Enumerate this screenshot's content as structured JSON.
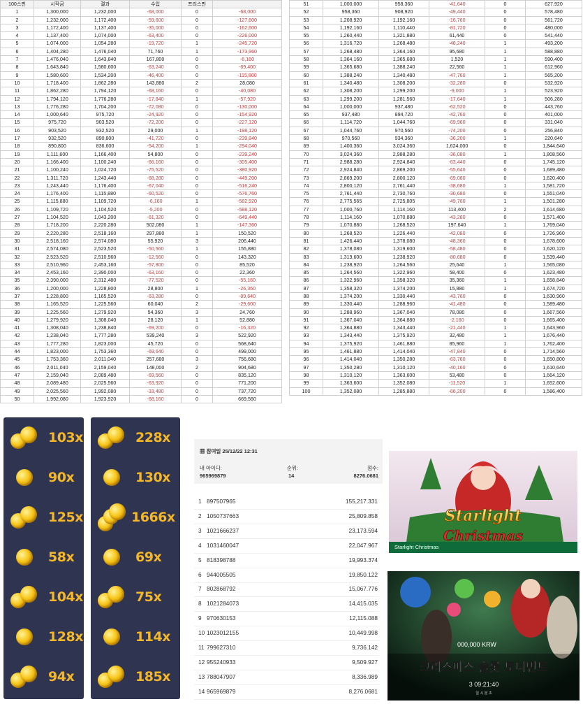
{
  "spin_table": {
    "headers": [
      "100스핀",
      "시작금",
      "결과",
      "수입",
      "프리스핀",
      ""
    ],
    "rows_left": [
      [
        "1",
        "1,300,000",
        "1,232,000",
        "-68,000",
        "0",
        "-68,000"
      ],
      [
        "2",
        "1,232,000",
        "1,172,400",
        "-59,600",
        "0",
        "-127,600"
      ],
      [
        "3",
        "1,172,400",
        "1,137,400",
        "-35,000",
        "0",
        "-162,600"
      ],
      [
        "4",
        "1,137,400",
        "1,074,000",
        "-63,400",
        "0",
        "-226,000"
      ],
      [
        "5",
        "1,074,000",
        "1,054,280",
        "-19,720",
        "1",
        "-245,720"
      ],
      [
        "6",
        "1,404,280",
        "1,476,040",
        "71,760",
        "1",
        "-173,960"
      ],
      [
        "7",
        "1,476,040",
        "1,643,840",
        "167,800",
        "0",
        "-6,160"
      ],
      [
        "8",
        "1,643,840",
        "1,580,600",
        "-63,240",
        "0",
        "-69,400"
      ],
      [
        "9",
        "1,580,600",
        "1,534,200",
        "-46,400",
        "0",
        "-115,800"
      ],
      [
        "10",
        "1,718,400",
        "1,862,280",
        "143,880",
        "2",
        "28,080"
      ],
      [
        "11",
        "1,862,280",
        "1,794,120",
        "-68,160",
        "0",
        "-40,080"
      ],
      [
        "12",
        "1,794,120",
        "1,776,280",
        "-17,840",
        "1",
        "-57,920"
      ],
      [
        "13",
        "1,776,280",
        "1,704,200",
        "-72,080",
        "0",
        "-130,000"
      ],
      [
        "14",
        "1,000,640",
        "975,720",
        "-24,920",
        "0",
        "-154,920"
      ],
      [
        "15",
        "975,720",
        "903,520",
        "-72,200",
        "0",
        "-227,120"
      ],
      [
        "16",
        "903,520",
        "932,520",
        "29,000",
        "1",
        "-198,120"
      ],
      [
        "17",
        "932,520",
        "890,800",
        "-41,720",
        "0",
        "-239,840"
      ],
      [
        "18",
        "890,800",
        "836,600",
        "-54,200",
        "1",
        "-294,040"
      ],
      [
        "19",
        "1,111,600",
        "1,166,400",
        "54,800",
        "0",
        "-239,240"
      ],
      [
        "20",
        "1,166,400",
        "1,100,240",
        "-66,160",
        "0",
        "-305,400"
      ],
      [
        "21",
        "1,100,240",
        "1,024,720",
        "-75,520",
        "0",
        "-380,920"
      ],
      [
        "22",
        "1,311,720",
        "1,243,440",
        "-68,280",
        "0",
        "-449,200"
      ],
      [
        "23",
        "1,243,440",
        "1,176,400",
        "-67,040",
        "0",
        "-516,240"
      ],
      [
        "24",
        "1,176,400",
        "1,115,880",
        "-60,520",
        "0",
        "-576,760"
      ],
      [
        "25",
        "1,115,880",
        "1,109,720",
        "-6,160",
        "1",
        "-582,920"
      ],
      [
        "26",
        "1,109,720",
        "1,104,520",
        "-5,200",
        "0",
        "-588,120"
      ],
      [
        "27",
        "1,104,520",
        "1,043,200",
        "-61,320",
        "0",
        "-649,440"
      ],
      [
        "28",
        "1,718,200",
        "2,220,280",
        "502,080",
        "1",
        "-147,360"
      ],
      [
        "29",
        "2,220,280",
        "2,518,160",
        "297,880",
        "1",
        "150,520"
      ],
      [
        "30",
        "2,518,160",
        "2,574,080",
        "55,920",
        "3",
        "206,440"
      ],
      [
        "31",
        "2,574,080",
        "2,523,520",
        "-50,560",
        "1",
        "155,880"
      ],
      [
        "32",
        "2,523,520",
        "2,510,960",
        "-12,560",
        "0",
        "143,320"
      ],
      [
        "33",
        "2,510,960",
        "2,453,160",
        "-57,800",
        "0",
        "85,520"
      ],
      [
        "34",
        "2,453,160",
        "2,390,000",
        "-63,160",
        "0",
        "22,360"
      ],
      [
        "35",
        "2,390,000",
        "2,312,480",
        "-77,520",
        "0",
        "-55,160"
      ],
      [
        "36",
        "1,200,000",
        "1,228,800",
        "28,800",
        "1",
        "-26,360"
      ],
      [
        "37",
        "1,228,800",
        "1,165,520",
        "-63,280",
        "0",
        "-89,640"
      ],
      [
        "38",
        "1,165,520",
        "1,225,560",
        "60,040",
        "2",
        "-29,600"
      ],
      [
        "39",
        "1,225,560",
        "1,279,920",
        "54,360",
        "3",
        "24,760"
      ],
      [
        "40",
        "1,279,920",
        "1,308,040",
        "28,120",
        "1",
        "52,880"
      ],
      [
        "41",
        "1,308,040",
        "1,238,840",
        "-69,200",
        "0",
        "-16,320"
      ],
      [
        "42",
        "1,238,040",
        "1,777,280",
        "539,240",
        "3",
        "522,920"
      ],
      [
        "43",
        "1,777,280",
        "1,823,000",
        "45,720",
        "0",
        "568,640"
      ],
      [
        "44",
        "1,823,000",
        "1,753,360",
        "-69,640",
        "0",
        "499,000"
      ],
      [
        "45",
        "1,753,360",
        "2,011,040",
        "257,680",
        "3",
        "756,680"
      ],
      [
        "46",
        "2,011,040",
        "2,159,040",
        "148,000",
        "2",
        "904,680"
      ],
      [
        "47",
        "2,159,040",
        "2,089,480",
        "-69,560",
        "0",
        "835,120"
      ],
      [
        "48",
        "2,089,480",
        "2,025,560",
        "-63,920",
        "0",
        "771,200"
      ],
      [
        "49",
        "2,025,560",
        "1,992,080",
        "-33,480",
        "0",
        "737,720"
      ],
      [
        "50",
        "1,992,080",
        "1,923,920",
        "-68,160",
        "0",
        "669,560"
      ]
    ],
    "rows_right": [
      [
        "51",
        "1,000,000",
        "958,360",
        "-41,640",
        "0",
        "627,920"
      ],
      [
        "52",
        "958,360",
        "908,920",
        "-49,440",
        "0",
        "578,480"
      ],
      [
        "53",
        "1,208,920",
        "1,192,160",
        "-16,760",
        "0",
        "561,720"
      ],
      [
        "54",
        "1,192,160",
        "1,110,440",
        "-81,720",
        "0",
        "480,000"
      ],
      [
        "55",
        "1,260,440",
        "1,321,880",
        "61,440",
        "0",
        "541,440"
      ],
      [
        "56",
        "1,316,720",
        "1,268,480",
        "-48,240",
        "1",
        "493,200"
      ],
      [
        "57",
        "1,268,480",
        "1,364,160",
        "95,680",
        "1",
        "588,880"
      ],
      [
        "58",
        "1,364,160",
        "1,365,680",
        "1,520",
        "1",
        "590,400"
      ],
      [
        "59",
        "1,365,680",
        "1,388,240",
        "22,560",
        "1",
        "612,960"
      ],
      [
        "60",
        "1,388,240",
        "1,340,480",
        "-47,760",
        "1",
        "565,200"
      ],
      [
        "61",
        "1,340,480",
        "1,308,200",
        "-32,280",
        "0",
        "532,920"
      ],
      [
        "62",
        "1,308,200",
        "1,299,200",
        "-9,000",
        "1",
        "523,920"
      ],
      [
        "63",
        "1,299,200",
        "1,281,560",
        "-17,640",
        "1",
        "506,280"
      ],
      [
        "64",
        "1,000,000",
        "937,480",
        "-62,520",
        "0",
        "443,760"
      ],
      [
        "65",
        "937,480",
        "894,720",
        "-42,760",
        "0",
        "401,000"
      ],
      [
        "66",
        "1,114,720",
        "1,044,760",
        "-69,960",
        "0",
        "331,040"
      ],
      [
        "67",
        "1,044,760",
        "970,560",
        "-74,200",
        "0",
        "256,840"
      ],
      [
        "68",
        "970,560",
        "934,360",
        "-36,200",
        "1",
        "220,640"
      ],
      [
        "69",
        "1,400,360",
        "3,024,360",
        "1,624,000",
        "0",
        "1,844,640"
      ],
      [
        "70",
        "3,024,360",
        "2,988,280",
        "-36,080",
        "1",
        "1,808,560"
      ],
      [
        "71",
        "2,988,280",
        "2,924,840",
        "-63,440",
        "0",
        "1,745,120"
      ],
      [
        "72",
        "2,924,840",
        "2,869,200",
        "-55,640",
        "0",
        "1,689,480"
      ],
      [
        "73",
        "2,869,200",
        "2,800,120",
        "-69,080",
        "0",
        "1,620,400"
      ],
      [
        "74",
        "2,800,120",
        "2,761,440",
        "-38,680",
        "1",
        "1,581,720"
      ],
      [
        "75",
        "2,761,440",
        "2,730,760",
        "-30,680",
        "0",
        "1,551,040"
      ],
      [
        "76",
        "2,775,565",
        "2,725,805",
        "-49,760",
        "1",
        "1,501,280"
      ],
      [
        "77",
        "1,000,760",
        "1,114,160",
        "113,400",
        "2",
        "1,614,680"
      ],
      [
        "78",
        "1,114,160",
        "1,070,880",
        "-43,280",
        "0",
        "1,571,400"
      ],
      [
        "79",
        "1,070,880",
        "1,268,520",
        "197,640",
        "1",
        "1,769,040"
      ],
      [
        "80",
        "1,268,520",
        "1,226,440",
        "-42,080",
        "0",
        "1,726,960"
      ],
      [
        "81",
        "1,426,440",
        "1,378,080",
        "-48,360",
        "0",
        "1,678,600"
      ],
      [
        "82",
        "1,378,080",
        "1,319,600",
        "-58,480",
        "0",
        "1,620,120"
      ],
      [
        "83",
        "1,319,600",
        "1,238,920",
        "-80,680",
        "0",
        "1,539,440"
      ],
      [
        "84",
        "1,238,920",
        "1,264,560",
        "25,640",
        "1",
        "1,565,080"
      ],
      [
        "85",
        "1,264,560",
        "1,322,960",
        "58,400",
        "0",
        "1,623,480"
      ],
      [
        "86",
        "1,322,960",
        "1,358,320",
        "35,360",
        "1",
        "1,658,840"
      ],
      [
        "87",
        "1,358,320",
        "1,374,200",
        "15,880",
        "1",
        "1,674,720"
      ],
      [
        "88",
        "1,374,200",
        "1,330,440",
        "-43,760",
        "0",
        "1,630,960"
      ],
      [
        "89",
        "1,330,440",
        "1,288,960",
        "-41,480",
        "0",
        "1,589,480"
      ],
      [
        "90",
        "1,288,960",
        "1,367,040",
        "78,080",
        "0",
        "1,667,560"
      ],
      [
        "91",
        "1,367,040",
        "1,364,880",
        "-2,160",
        "0",
        "1,665,400"
      ],
      [
        "92",
        "1,364,880",
        "1,343,440",
        "-21,440",
        "1",
        "1,643,960"
      ],
      [
        "93",
        "1,343,440",
        "1,375,920",
        "32,480",
        "1",
        "1,676,440"
      ],
      [
        "94",
        "1,375,920",
        "1,461,880",
        "85,960",
        "1",
        "1,762,400"
      ],
      [
        "95",
        "1,461,880",
        "1,414,040",
        "-47,840",
        "0",
        "1,714,560"
      ],
      [
        "96",
        "1,414,040",
        "1,350,280",
        "-63,760",
        "0",
        "1,650,800"
      ],
      [
        "97",
        "1,350,280",
        "1,310,120",
        "-40,160",
        "0",
        "1,610,640"
      ],
      [
        "98",
        "1,310,120",
        "1,363,600",
        "53,480",
        "0",
        "1,664,120"
      ],
      [
        "99",
        "1,363,600",
        "1,352,080",
        "-11,520",
        "1",
        "1,652,600"
      ],
      [
        "100",
        "1,352,080",
        "1,285,880",
        "-66,200",
        "0",
        "1,586,400"
      ]
    ]
  },
  "multipliers_left": [
    "103x",
    "90x",
    "125x",
    "58x",
    "104x",
    "128x",
    "94x"
  ],
  "multipliers_right": [
    "228x",
    "130x",
    "1666x",
    "69x",
    "75x",
    "114x",
    "185x"
  ],
  "ranking": {
    "date_label": "참여일",
    "date_value": "25/12/22 12:31",
    "my_id_label": "내 아이디:",
    "my_id": "965969879",
    "rank_label": "순위:",
    "rank": "14",
    "score_label": "점수:",
    "score": "8276.0681",
    "entries": [
      [
        "1",
        "897507965",
        "155,217.331"
      ],
      [
        "2",
        "1050737663",
        "25,809.858"
      ],
      [
        "3",
        "1021666237",
        "23,173.594"
      ],
      [
        "4",
        "1031460047",
        "22,047.967"
      ],
      [
        "5",
        "818398788",
        "19,993.374"
      ],
      [
        "6",
        "944005505",
        "19,850.122"
      ],
      [
        "7",
        "802868792",
        "15,067.776"
      ],
      [
        "8",
        "1021284073",
        "14,415.035"
      ],
      [
        "9",
        "970630153",
        "12,115.088"
      ],
      [
        "10",
        "1023012155",
        "10,449.998"
      ],
      [
        "11",
        "799627310",
        "9,736.142"
      ],
      [
        "12",
        "955240933",
        "9,509.927"
      ],
      [
        "13",
        "788047907",
        "8,336.989"
      ],
      [
        "14",
        "965969879",
        "8,276.0681"
      ]
    ]
  },
  "game_card": {
    "logo_text": "Starlight",
    "logo_text2": "Christmas",
    "caption": "Starlight Christmas"
  },
  "tournament_banner": {
    "prize": "000,000 KRW",
    "title": "크리스마스 슬롯 토너먼트",
    "timer": "3 09:21:40",
    "timer_sub": "일  시  분  초"
  },
  "colors": {
    "negative": "#e03131",
    "multiplier": "#f4b728",
    "panel_bg": "#2f3550",
    "banner_green": "#0f6b3a"
  }
}
